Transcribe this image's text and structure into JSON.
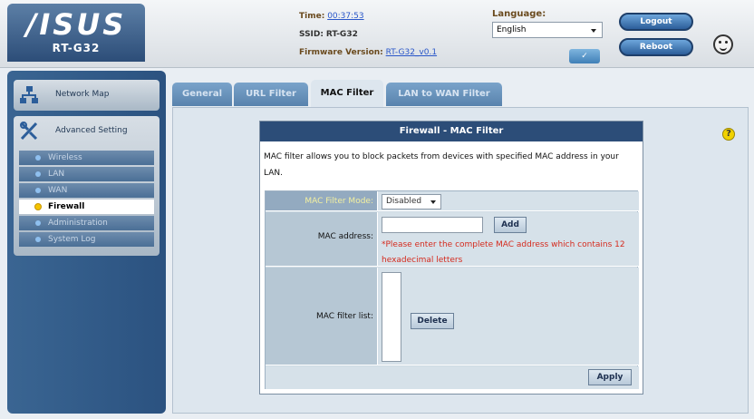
{
  "header": {
    "brand": "/ISUS",
    "model": "RT-G32",
    "time_label": "Time:",
    "time_value": "00:37:53",
    "ssid_label": "SSID:",
    "ssid_value": "RT-G32",
    "firmware_label": "Firmware Version:",
    "firmware_value": "RT-G32_v0.1",
    "language_label": "Language:",
    "language_value": "English",
    "logout_label": "Logout",
    "reboot_label": "Reboot"
  },
  "sidebar": {
    "network_map": "Network Map",
    "advanced_setting": "Advanced Setting",
    "items": [
      {
        "label": "Wireless",
        "active": false
      },
      {
        "label": "LAN",
        "active": false
      },
      {
        "label": "WAN",
        "active": false
      },
      {
        "label": "Firewall",
        "active": true
      },
      {
        "label": "Administration",
        "active": false
      },
      {
        "label": "System Log",
        "active": false
      }
    ]
  },
  "tabs": [
    {
      "label": "General",
      "active": false
    },
    {
      "label": "URL Filter",
      "active": false
    },
    {
      "label": "MAC Filter",
      "active": true
    },
    {
      "label": "LAN to WAN Filter",
      "active": false
    }
  ],
  "panel": {
    "title": "Firewall - MAC Filter",
    "description": "MAC filter allows you to block packets from devices with specified MAC address in your LAN.",
    "mode_label": "MAC Filter Mode:",
    "mode_value": "Disabled",
    "mac_label": "MAC address:",
    "mac_value": "",
    "add_label": "Add",
    "mac_hint": "*Please enter the complete MAC address which contains 12 hexadecimal letters",
    "list_label": "MAC filter list:",
    "delete_label": "Delete",
    "apply_label": "Apply"
  },
  "help": "?"
}
